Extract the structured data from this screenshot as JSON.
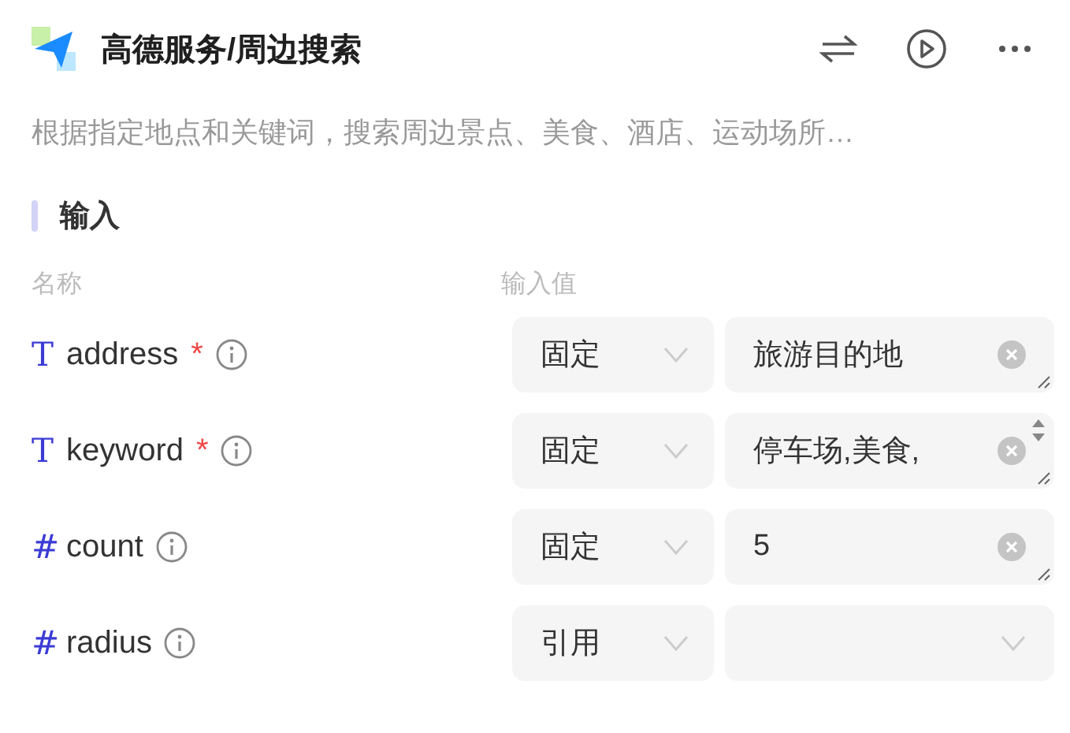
{
  "header": {
    "title": "高德服务/周边搜索"
  },
  "description": "根据指定地点和关键词，搜索周边景点、美食、酒店、运动场所…",
  "section": {
    "title": "输入",
    "columns": [
      "名称",
      "输入值"
    ]
  },
  "params": [
    {
      "kind": "input",
      "type_icon": "T",
      "name": "address",
      "required_mark": "*",
      "mode": "固定",
      "value": "旅游目的地",
      "scrollable": false
    },
    {
      "kind": "input",
      "type_icon": "T",
      "name": "keyword",
      "required_mark": "*",
      "mode": "固定",
      "value": "停车场,美食,",
      "scrollable": true
    },
    {
      "kind": "input",
      "type_icon": "#",
      "name": "count",
      "mode": "固定",
      "value": "5",
      "scrollable": false
    },
    {
      "kind": "select",
      "type_icon": "#",
      "name": "radius",
      "mode": "引用",
      "scrollable": false
    }
  ]
}
